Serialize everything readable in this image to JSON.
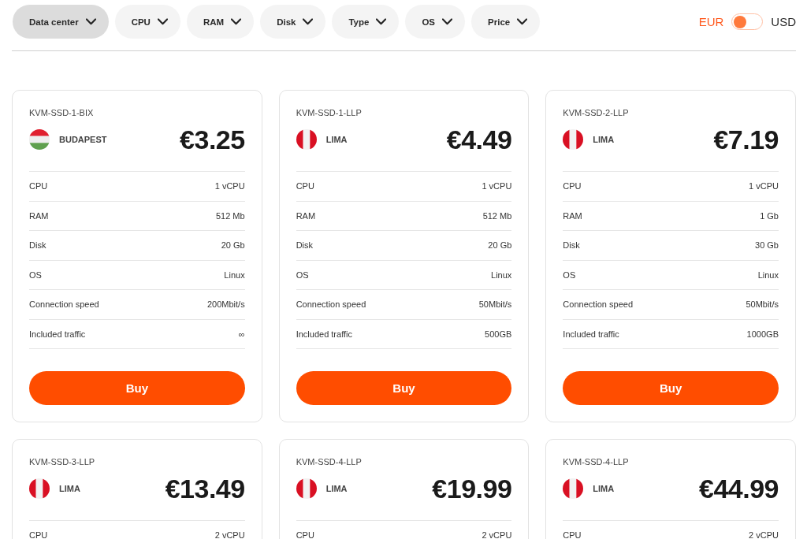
{
  "filters": [
    {
      "label": "Data center",
      "selected": true
    },
    {
      "label": "CPU",
      "selected": false
    },
    {
      "label": "RAM",
      "selected": false
    },
    {
      "label": "Disk",
      "selected": false
    },
    {
      "label": "Type",
      "selected": false
    },
    {
      "label": "OS",
      "selected": false
    },
    {
      "label": "Price",
      "selected": false
    }
  ],
  "currency": {
    "options": [
      {
        "label": "EUR",
        "selected": true
      },
      {
        "label": "USD",
        "selected": false
      }
    ]
  },
  "cards": [
    {
      "name": "KVM-SSD-1-BIX",
      "flag": {
        "kind": "horizontal",
        "stripes": [
          {
            "color": "#e0202f"
          },
          {
            "color": "#eeeeee"
          },
          {
            "color": "#5fa04e"
          }
        ]
      },
      "location": "BUDAPEST",
      "price": "€3.25",
      "specs": [
        {
          "label": "CPU",
          "value": "1 vCPU"
        },
        {
          "label": "RAM",
          "value": "512 Mb"
        },
        {
          "label": "Disk",
          "value": "20 Gb"
        },
        {
          "label": "OS",
          "value": "Linux"
        },
        {
          "label": "Connection speed",
          "value": "200Mbit/s"
        },
        {
          "label": "Included traffic",
          "value": "∞"
        }
      ],
      "button": "Buy"
    },
    {
      "name": "KVM-SSD-1-LLP",
      "flag": {
        "kind": "vertical",
        "stripes": [
          {
            "color": "#d91023"
          },
          {
            "color": "#f2f2f2"
          },
          {
            "color": "#d91023"
          }
        ]
      },
      "location": "LIMA",
      "price": "€4.49",
      "specs": [
        {
          "label": "CPU",
          "value": "1 vCPU"
        },
        {
          "label": "RAM",
          "value": "512 Mb"
        },
        {
          "label": "Disk",
          "value": "20 Gb"
        },
        {
          "label": "OS",
          "value": "Linux"
        },
        {
          "label": "Connection speed",
          "value": "50Mbit/s"
        },
        {
          "label": "Included traffic",
          "value": "500GB"
        }
      ],
      "button": "Buy"
    },
    {
      "name": "KVM-SSD-2-LLP",
      "flag": {
        "kind": "vertical",
        "stripes": [
          {
            "color": "#d91023"
          },
          {
            "color": "#f2f2f2"
          },
          {
            "color": "#d91023"
          }
        ]
      },
      "location": "LIMA",
      "price": "€7.19",
      "specs": [
        {
          "label": "CPU",
          "value": "1 vCPU"
        },
        {
          "label": "RAM",
          "value": "1 Gb"
        },
        {
          "label": "Disk",
          "value": "30 Gb"
        },
        {
          "label": "OS",
          "value": "Linux"
        },
        {
          "label": "Connection speed",
          "value": "50Mbit/s"
        },
        {
          "label": "Included traffic",
          "value": "1000GB"
        }
      ],
      "button": "Buy"
    },
    {
      "name": "KVM-SSD-3-LLP",
      "flag": {
        "kind": "vertical",
        "stripes": [
          {
            "color": "#d91023"
          },
          {
            "color": "#f2f2f2"
          },
          {
            "color": "#d91023"
          }
        ]
      },
      "location": "LIMA",
      "price": "€13.49",
      "specs": [
        {
          "label": "CPU",
          "value": "2 vCPU"
        }
      ]
    },
    {
      "name": "KVM-SSD-4-LLP",
      "flag": {
        "kind": "vertical",
        "stripes": [
          {
            "color": "#d91023"
          },
          {
            "color": "#f2f2f2"
          },
          {
            "color": "#d91023"
          }
        ]
      },
      "location": "LIMA",
      "price": "€19.99",
      "specs": [
        {
          "label": "CPU",
          "value": "2 vCPU"
        }
      ]
    },
    {
      "name": "KVM-SSD-4-LLP",
      "flag": {
        "kind": "vertical",
        "stripes": [
          {
            "color": "#d91023"
          },
          {
            "color": "#f2f2f2"
          },
          {
            "color": "#d91023"
          }
        ]
      },
      "location": "LIMA",
      "price": "€44.99",
      "specs": [
        {
          "label": "CPU",
          "value": "2 vCPU"
        }
      ]
    }
  ]
}
